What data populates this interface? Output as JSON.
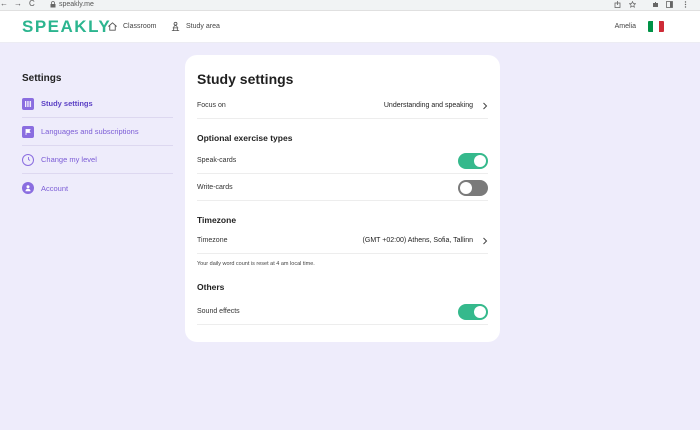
{
  "browser": {
    "nav_glyphs": [
      "←",
      "→",
      "C"
    ],
    "url": "speakly.me"
  },
  "header": {
    "logo": "SPEAKLY",
    "nav": [
      {
        "label": "Classroom",
        "icon": "house-icon"
      },
      {
        "label": "Study area",
        "icon": "study-desk-icon"
      }
    ],
    "user_name": "Amelia",
    "flag_colors": [
      "#009246",
      "#ffffff",
      "#ce2b37"
    ]
  },
  "sidebar": {
    "title": "Settings",
    "items": [
      {
        "label": "Study settings",
        "icon": "study-grid-icon",
        "active": true
      },
      {
        "label": "Languages and subscriptions",
        "icon": "flag-icon",
        "active": false
      },
      {
        "label": "Change my level",
        "icon": "level-ring-icon",
        "active": false
      },
      {
        "label": "Account",
        "icon": "user-icon",
        "active": false
      }
    ]
  },
  "main": {
    "title": "Study settings",
    "focus": {
      "label": "Focus on",
      "value": "Understanding and speaking"
    },
    "optional_section": "Optional exercise types",
    "speak_cards": {
      "label": "Speak-cards",
      "enabled": true
    },
    "write_cards": {
      "label": "Write-cards",
      "enabled": false
    },
    "timezone_section": "Timezone",
    "timezone": {
      "label": "Timezone",
      "value": "(GMT +02:00) Athens, Sofia, Tallinn"
    },
    "timezone_note": "Your daily word count is reset at 4 am local time.",
    "others_section": "Others",
    "sound_effects": {
      "label": "Sound effects",
      "enabled": true
    }
  },
  "colors": {
    "brand": "#2cb58f",
    "accent_purple": "#7b5cd6",
    "toggle_on": "#35b98c",
    "toggle_off": "#7a7a7a",
    "page_bg": "#eeecfb"
  }
}
